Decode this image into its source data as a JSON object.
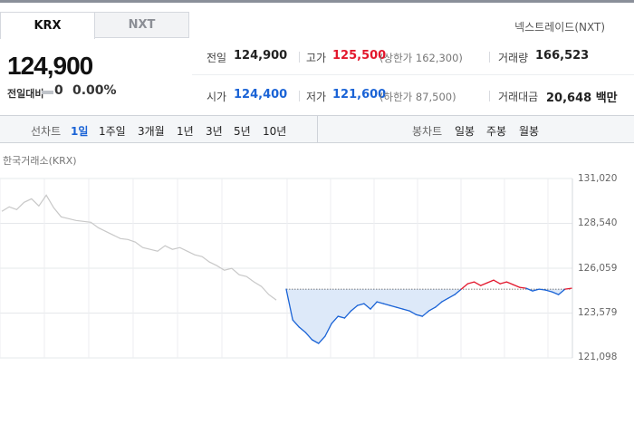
{
  "tabs": [
    {
      "label": "KRX",
      "active": true
    },
    {
      "label": "NXT",
      "active": false
    }
  ],
  "nxt_link": "넥스트레이드(NXT)",
  "price": {
    "current": "124,900",
    "change_label": "전일대비",
    "change_value": "0",
    "change_percent": "0.00%"
  },
  "quotes": {
    "prev_close": {
      "label": "전일",
      "value": "124,900"
    },
    "high": {
      "label": "고가",
      "value": "125,500",
      "limit_label": "(상한가 162,300)"
    },
    "volume": {
      "label": "거래량",
      "value": "166,523"
    },
    "open": {
      "label": "시가",
      "value": "124,400"
    },
    "low": {
      "label": "저가",
      "value": "121,600",
      "limit_label": "(하한가 87,500)"
    },
    "trade_value": {
      "label": "거래대금",
      "value": "20,648 백만"
    }
  },
  "toolbar": {
    "line_chart_label": "선차트",
    "periods": [
      "1일",
      "1주일",
      "3개월",
      "1년",
      "3년",
      "5년",
      "10년"
    ],
    "active_period": "1일",
    "candle_chart_label": "봉차트",
    "candle_periods": [
      "일봉",
      "주봉",
      "월봉"
    ]
  },
  "chart_source": "한국거래소(KRX)",
  "colors": {
    "up": "#e3172c",
    "down": "#1a63d6",
    "prev_day_line": "#c8c8c8",
    "fill_down": "#dde9f9"
  },
  "chart_data": {
    "type": "line",
    "y_ticks": [
      "131,020",
      "128,540",
      "126,059",
      "123,579",
      "121,098"
    ],
    "ylim": [
      121098,
      131020
    ],
    "reference_price": 124900,
    "previous_session": [
      [
        0,
        129200
      ],
      [
        1,
        129450
      ],
      [
        2,
        129300
      ],
      [
        3,
        129700
      ],
      [
        4,
        129900
      ],
      [
        5,
        129500
      ],
      [
        6,
        130100
      ],
      [
        7,
        129400
      ],
      [
        8,
        128900
      ],
      [
        9,
        128800
      ],
      [
        10,
        128700
      ],
      [
        11,
        128650
      ],
      [
        12,
        128600
      ],
      [
        13,
        128300
      ],
      [
        14,
        128100
      ],
      [
        15,
        127900
      ],
      [
        16,
        127700
      ],
      [
        17,
        127650
      ],
      [
        18,
        127500
      ],
      [
        19,
        127200
      ],
      [
        20,
        127100
      ],
      [
        21,
        127000
      ],
      [
        22,
        127300
      ],
      [
        23,
        127100
      ],
      [
        24,
        127200
      ],
      [
        25,
        127000
      ],
      [
        26,
        126800
      ],
      [
        27,
        126700
      ],
      [
        28,
        126400
      ],
      [
        29,
        126200
      ],
      [
        30,
        125950
      ],
      [
        31,
        126050
      ],
      [
        32,
        125700
      ],
      [
        33,
        125600
      ],
      [
        34,
        125300
      ],
      [
        35,
        125050
      ],
      [
        36,
        124600
      ],
      [
        37,
        124300
      ]
    ],
    "today": [
      [
        0,
        124900
      ],
      [
        1,
        123200
      ],
      [
        2,
        122800
      ],
      [
        3,
        122500
      ],
      [
        4,
        122100
      ],
      [
        5,
        121900
      ],
      [
        6,
        122300
      ],
      [
        7,
        123000
      ],
      [
        8,
        123400
      ],
      [
        9,
        123300
      ],
      [
        10,
        123700
      ],
      [
        11,
        124000
      ],
      [
        12,
        124100
      ],
      [
        13,
        123800
      ],
      [
        14,
        124200
      ],
      [
        15,
        124100
      ],
      [
        16,
        124000
      ],
      [
        17,
        123900
      ],
      [
        18,
        123800
      ],
      [
        19,
        123700
      ],
      [
        20,
        123500
      ],
      [
        21,
        123400
      ],
      [
        22,
        123700
      ],
      [
        23,
        123900
      ],
      [
        24,
        124200
      ],
      [
        25,
        124400
      ],
      [
        26,
        124600
      ],
      [
        27,
        124900
      ],
      [
        28,
        125200
      ],
      [
        29,
        125300
      ],
      [
        30,
        125100
      ],
      [
        31,
        125250
      ],
      [
        32,
        125400
      ],
      [
        33,
        125200
      ],
      [
        34,
        125300
      ],
      [
        35,
        125150
      ],
      [
        36,
        125000
      ],
      [
        37,
        124950
      ],
      [
        38,
        124800
      ],
      [
        39,
        124900
      ],
      [
        40,
        124850
      ],
      [
        41,
        124750
      ],
      [
        42,
        124600
      ],
      [
        43,
        124900
      ],
      [
        44,
        124950
      ]
    ]
  }
}
